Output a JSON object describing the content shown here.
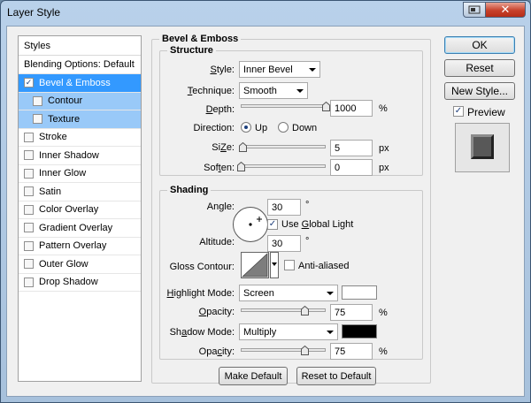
{
  "window": {
    "title": "Layer Style"
  },
  "styles_list": {
    "header": "Styles",
    "blending_options": "Blending Options: Default",
    "items": [
      {
        "label": "Bevel & Emboss",
        "checked": true,
        "state": "selected"
      },
      {
        "label": "Contour",
        "checked": false,
        "state": "sub"
      },
      {
        "label": "Texture",
        "checked": false,
        "state": "sub"
      },
      {
        "label": "Stroke",
        "checked": false,
        "state": "normal"
      },
      {
        "label": "Inner Shadow",
        "checked": false,
        "state": "normal"
      },
      {
        "label": "Inner Glow",
        "checked": false,
        "state": "normal"
      },
      {
        "label": "Satin",
        "checked": false,
        "state": "normal"
      },
      {
        "label": "Color Overlay",
        "checked": false,
        "state": "normal"
      },
      {
        "label": "Gradient Overlay",
        "checked": false,
        "state": "normal"
      },
      {
        "label": "Pattern Overlay",
        "checked": false,
        "state": "normal"
      },
      {
        "label": "Outer Glow",
        "checked": false,
        "state": "normal"
      },
      {
        "label": "Drop Shadow",
        "checked": false,
        "state": "normal"
      }
    ]
  },
  "bevel": {
    "title": "Bevel & Emboss",
    "structure": {
      "title": "Structure",
      "style_label_pre": "",
      "style_label_u": "S",
      "style_label_post": "tyle:",
      "style_value": "Inner Bevel",
      "technique_label_u": "T",
      "technique_label_post": "echnique:",
      "technique_value": "Smooth",
      "depth_label_u": "D",
      "depth_label_post": "epth:",
      "depth_value": "1000",
      "depth_unit": "%",
      "depth_level": 1.0,
      "direction_label": "Direction:",
      "direction_up": "Up",
      "direction_down": "Down",
      "direction_selected": "Up",
      "size_label_u": "Z",
      "size_label_pre": "Si",
      "size_label_post": "e:",
      "size_value": "5",
      "size_unit": "px",
      "size_level": 0.02,
      "soften_label_pre": "Sof",
      "soften_label_u": "t",
      "soften_label_post": "en:",
      "soften_value": "0",
      "soften_unit": "px",
      "soften_level": 0.0
    },
    "shading": {
      "title": "Shading",
      "angle_label_pre": "An",
      "angle_label_u": "g",
      "angle_label_post": "le:",
      "angle_value": "30",
      "angle_unit": "°",
      "use_global_light_pre": "Use ",
      "use_global_light_u": "G",
      "use_global_light_post": "lobal Light",
      "use_global_light_checked": true,
      "altitude_label": "Altitude:",
      "altitude_value": "30",
      "altitude_unit": "°",
      "gloss_contour_label": "Gloss Contour:",
      "anti_aliased_label": "Anti-aliased",
      "anti_aliased_checked": false,
      "highlight_mode_label_u": "H",
      "highlight_mode_label_post": "ighlight Mode:",
      "highlight_mode_value": "Screen",
      "highlight_color": "#ffffff",
      "highlight_opacity_label_u": "O",
      "highlight_opacity_label_post": "pacity:",
      "highlight_opacity_value": "75",
      "highlight_opacity_unit": "%",
      "highlight_opacity_level": 0.75,
      "shadow_mode_label_pre": "Sh",
      "shadow_mode_label_u": "a",
      "shadow_mode_label_post": "dow Mode:",
      "shadow_mode_value": "Multiply",
      "shadow_color": "#000000",
      "shadow_opacity_label_pre": "Opa",
      "shadow_opacity_label_u": "c",
      "shadow_opacity_label_post": "ity:",
      "shadow_opacity_value": "75",
      "shadow_opacity_unit": "%",
      "shadow_opacity_level": 0.75
    },
    "make_default": "Make Default",
    "reset_to_default": "Reset to Default"
  },
  "buttons": {
    "ok": "OK",
    "reset": "Reset",
    "new_style": "New Style...",
    "preview_label": "Preview",
    "preview_checked": true
  },
  "colors": {
    "selection": "#3399ff",
    "sub_selection": "#99c9f8",
    "default_button_border": "#3c7fb1"
  }
}
